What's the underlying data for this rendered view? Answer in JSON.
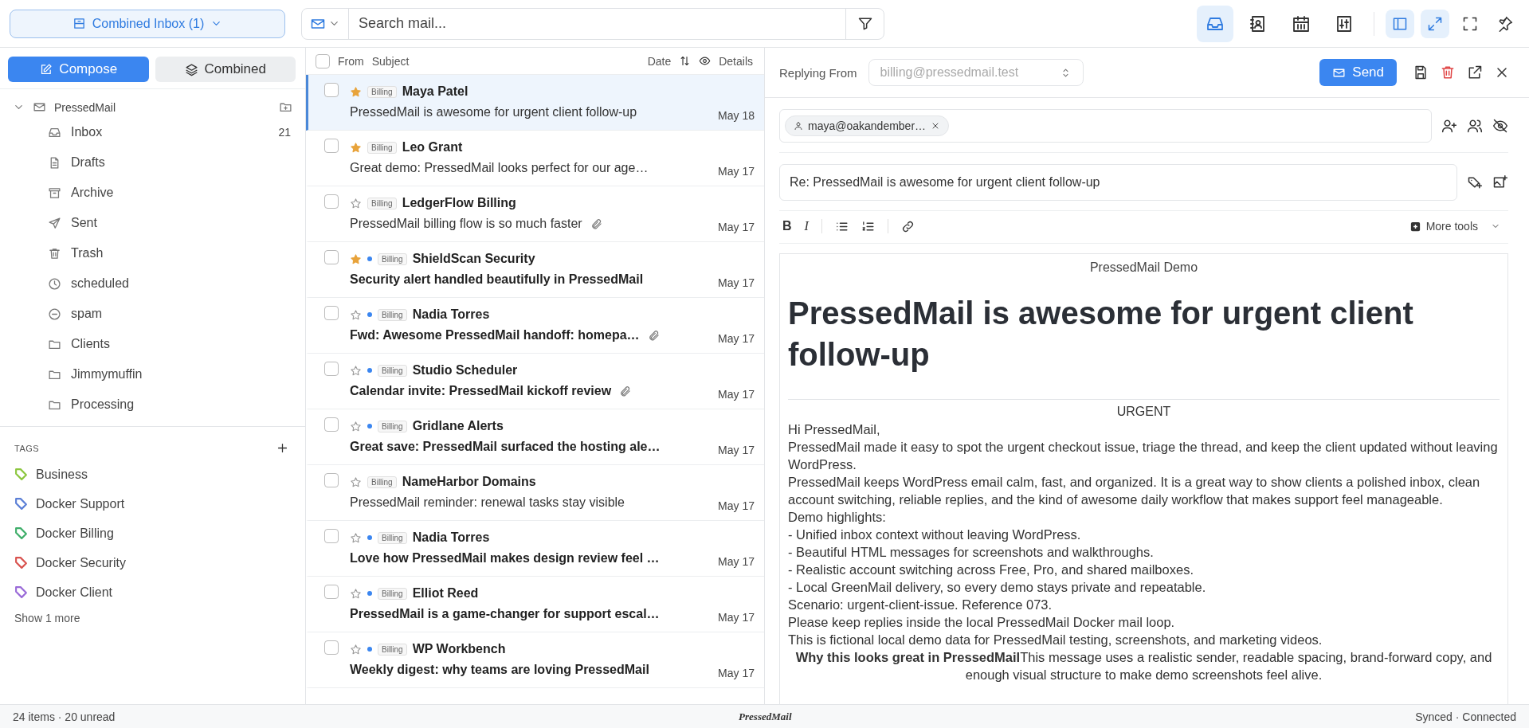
{
  "topbar": {
    "account_switch": "Combined Inbox (1)",
    "search": {
      "placeholder": "Search mail..."
    },
    "app_tools": [
      {
        "kind": "inbox",
        "selected": true
      },
      {
        "kind": "contacts",
        "selected": false
      },
      {
        "kind": "calendar",
        "selected": false
      },
      {
        "kind": "settings",
        "selected": false
      }
    ],
    "view_tools": [
      {
        "kind": "sidebar",
        "on": true
      },
      {
        "kind": "expand",
        "on": true
      },
      {
        "kind": "fullscreen",
        "on": false
      },
      {
        "kind": "pin",
        "on": false
      }
    ]
  },
  "sidebar": {
    "compose": "Compose",
    "combined": "Combined",
    "account": {
      "name": "PressedMail",
      "expanded": true
    },
    "folders": [
      {
        "kind": "inbox",
        "label": "Inbox",
        "count": "21"
      },
      {
        "kind": "drafts",
        "label": "Drafts"
      },
      {
        "kind": "archive",
        "label": "Archive"
      },
      {
        "kind": "sent",
        "label": "Sent"
      },
      {
        "kind": "trash",
        "label": "Trash"
      },
      {
        "kind": "scheduled",
        "label": "scheduled"
      },
      {
        "kind": "spam",
        "label": "spam"
      },
      {
        "kind": "folder",
        "label": "Clients"
      },
      {
        "kind": "folder",
        "label": "Jimmymuffin"
      },
      {
        "kind": "folder",
        "label": "Processing"
      }
    ],
    "tags_title": "TAGS",
    "tags": [
      {
        "label": "Business",
        "color": "#8cc63f"
      },
      {
        "label": "Docker Support",
        "color": "#5b7fd6"
      },
      {
        "label": "Docker Billing",
        "color": "#3fae6a"
      },
      {
        "label": "Docker Security",
        "color": "#d9534f"
      },
      {
        "label": "Docker Client",
        "color": "#9a6bd8"
      }
    ],
    "show_more": "Show 1 more"
  },
  "message_list": {
    "header": {
      "checked": false,
      "from": "From",
      "subject": "Subject",
      "date": "Date",
      "details": "Details"
    },
    "rows": [
      {
        "selected": true,
        "checked": false,
        "starred": true,
        "unread": false,
        "tag": "Billing",
        "sender": "Maya Patel",
        "subject": "PressedMail is awesome for urgent client follow-up",
        "attachment": false,
        "date": "May 18"
      },
      {
        "selected": false,
        "checked": false,
        "starred": true,
        "unread": false,
        "tag": "Billing",
        "sender": "Leo Grant",
        "subject": "Great demo: PressedMail looks perfect for our age…",
        "attachment": false,
        "date": "May 17"
      },
      {
        "selected": false,
        "checked": false,
        "starred": false,
        "unread": false,
        "tag": "Billing",
        "sender": "LedgerFlow Billing",
        "subject": "PressedMail billing flow is so much faster",
        "attachment": true,
        "date": "May 17"
      },
      {
        "selected": false,
        "checked": false,
        "starred": true,
        "unread": true,
        "tag": "Billing",
        "sender": "ShieldScan Security",
        "subject": "Security alert handled beautifully in PressedMail",
        "attachment": false,
        "date": "May 17"
      },
      {
        "selected": false,
        "checked": false,
        "starred": false,
        "unread": true,
        "tag": "Billing",
        "sender": "Nadia Torres",
        "subject": "Fwd: Awesome PressedMail handoff: homepa…",
        "attachment": true,
        "date": "May 17"
      },
      {
        "selected": false,
        "checked": false,
        "starred": false,
        "unread": true,
        "tag": "Billing",
        "sender": "Studio Scheduler",
        "subject": "Calendar invite: PressedMail kickoff review",
        "attachment": true,
        "date": "May 17"
      },
      {
        "selected": false,
        "checked": false,
        "starred": false,
        "unread": true,
        "tag": "Billing",
        "sender": "Gridlane Alerts",
        "subject": "Great save: PressedMail surfaced the hosting ale…",
        "attachment": false,
        "date": "May 17"
      },
      {
        "selected": false,
        "checked": false,
        "starred": false,
        "unread": false,
        "tag": "Billing",
        "sender": "NameHarbor Domains",
        "subject": "PressedMail reminder: renewal tasks stay visible",
        "attachment": false,
        "date": "May 17"
      },
      {
        "selected": false,
        "checked": false,
        "starred": false,
        "unread": true,
        "tag": "Billing",
        "sender": "Nadia Torres",
        "subject": "Love how PressedMail makes design review feel …",
        "attachment": false,
        "date": "May 17"
      },
      {
        "selected": false,
        "checked": false,
        "starred": false,
        "unread": true,
        "tag": "Billing",
        "sender": "Elliot Reed",
        "subject": "PressedMail is a game-changer for support escal…",
        "attachment": false,
        "date": "May 17"
      },
      {
        "selected": false,
        "checked": false,
        "starred": false,
        "unread": true,
        "tag": "Billing",
        "sender": "WP Workbench",
        "subject": "Weekly digest: why teams are loving PressedMail",
        "attachment": false,
        "date": "May 17"
      }
    ]
  },
  "composer": {
    "from_label": "Replying From",
    "from": {
      "value": "billing@pressedmail.test",
      "disabled": true
    },
    "send": "Send",
    "recipients": [
      "maya@oakandember…"
    ],
    "subject": "Re: PressedMail is awesome for urgent client follow-up",
    "formatting": [
      {
        "kind": "bold",
        "label": "B"
      },
      {
        "kind": "italic",
        "label": "I"
      },
      {
        "kind": "bullets"
      },
      {
        "kind": "numbers"
      },
      {
        "kind": "link"
      }
    ],
    "more_tools": "More tools",
    "body": {
      "preheader": "PressedMail Demo",
      "heading": "PressedMail is awesome for urgent client follow-up",
      "badge": "URGENT",
      "lines": [
        "Hi PressedMail,",
        "PressedMail made it easy to spot the urgent checkout issue, triage the thread, and keep the client updated without leaving WordPress.",
        "PressedMail keeps WordPress email calm, fast, and organized. It is a great way to show clients a polished inbox, clean account switching, reliable replies, and the kind of awesome daily workflow that makes support feel manageable.",
        "Demo highlights:",
        "- Unified inbox context without leaving WordPress.",
        "- Beautiful HTML messages for screenshots and walkthroughs.",
        "- Realistic account switching across Free, Pro, and shared mailboxes.",
        "- Local GreenMail delivery, so every demo stays private and repeatable.",
        "Scenario: urgent-client-issue. Reference 073.",
        "Please keep replies inside the local PressedMail Docker mail loop.",
        "This is fictional local demo data for PressedMail testing, screenshots, and marketing videos."
      ],
      "closing": "**Why this looks great in PressedMail**This message uses a realistic sender, readable spacing, brand-forward copy, and enough visual structure to make demo screenshots feel alive."
    }
  },
  "status_bar": {
    "counts": "24 items · 20 unread",
    "logo": "PressedMail",
    "sync": "Synced · Connected"
  }
}
